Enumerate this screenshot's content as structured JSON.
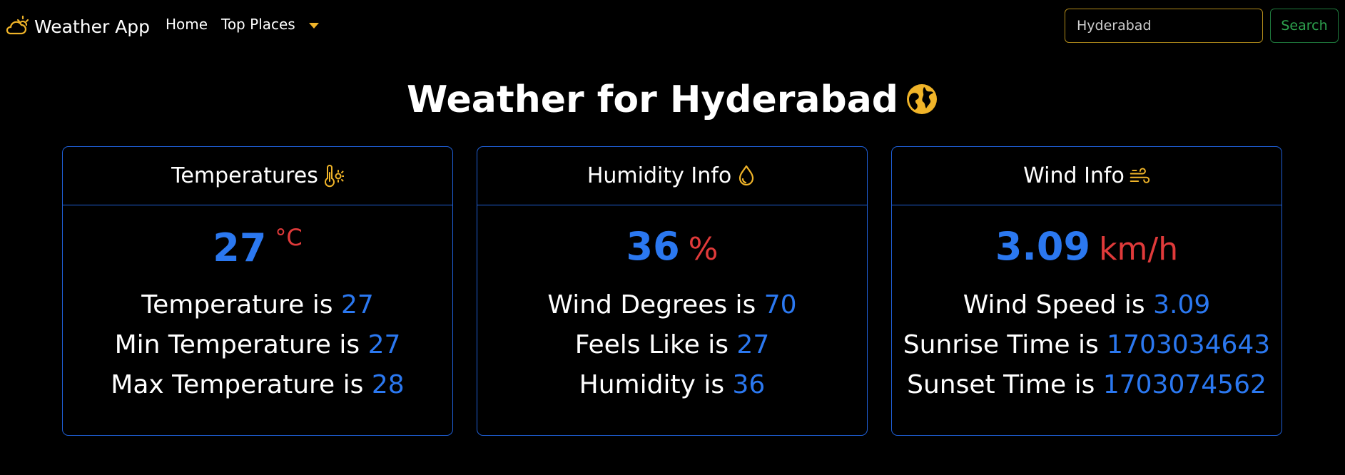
{
  "nav": {
    "brand": "Weather App",
    "home": "Home",
    "top_places": "Top Places"
  },
  "search": {
    "value": "Hyderabad",
    "button": "Search"
  },
  "title": "Weather for Hyderabad",
  "temperatures": {
    "header": "Temperatures",
    "big_value": "27",
    "big_unit": "°C",
    "lines": [
      {
        "label": "Temperature is",
        "value": "27"
      },
      {
        "label": "Min Temperature is",
        "value": "27"
      },
      {
        "label": "Max Temperature is",
        "value": "28"
      }
    ]
  },
  "humidity": {
    "header": "Humidity Info",
    "big_value": "36",
    "big_unit": "%",
    "lines": [
      {
        "label": "Wind Degrees is",
        "value": "70"
      },
      {
        "label": "Feels Like is",
        "value": "27"
      },
      {
        "label": "Humidity is",
        "value": "36"
      }
    ]
  },
  "wind": {
    "header": "Wind Info",
    "big_value": "3.09",
    "big_unit": "km/h",
    "lines": [
      {
        "label": "Wind Speed is",
        "value": "3.09"
      },
      {
        "label": "Sunrise Time is",
        "value": "1703034643"
      },
      {
        "label": "Sunset Time is",
        "value": "1703074562"
      }
    ]
  },
  "icons": {
    "brand": "cloud-sun-icon",
    "title": "globe-icon",
    "temperatures": "thermometer-sun-icon",
    "humidity": "droplet-icon",
    "wind": "wind-icon"
  },
  "colors": {
    "accent_yellow": "#f0b429",
    "value_blue": "#2b78f0",
    "unit_red": "#e03a3a",
    "card_border": "#1f5fd6",
    "search_button": "#2ea44f"
  }
}
